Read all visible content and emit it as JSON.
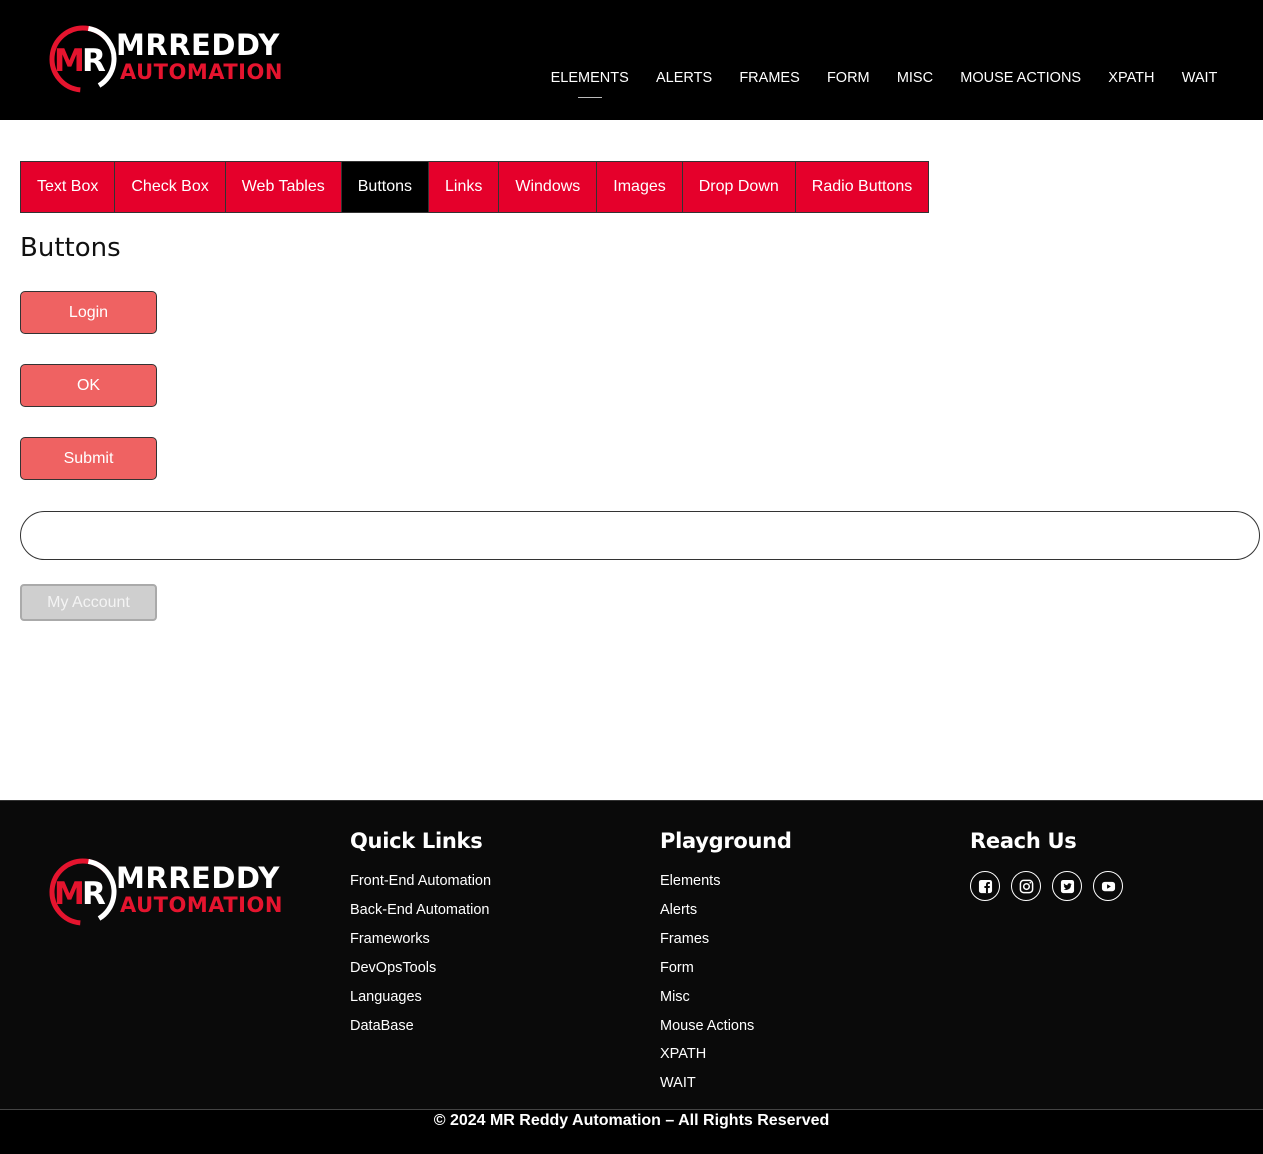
{
  "brand": {
    "line1": "MRREDDY",
    "line2": "AUTOMATION",
    "initials": "MR",
    "colors": {
      "accent": "#e5142e",
      "header_bg": "#000000"
    }
  },
  "topnav": {
    "items": [
      {
        "label": "ELEMENTS",
        "active": true
      },
      {
        "label": "ALERTS"
      },
      {
        "label": "FRAMES"
      },
      {
        "label": "FORM"
      },
      {
        "label": "MISC"
      },
      {
        "label": "MOUSE ACTIONS"
      },
      {
        "label": "XPATH"
      },
      {
        "label": "WAIT"
      }
    ]
  },
  "tabs": {
    "items": [
      {
        "label": "Text Box"
      },
      {
        "label": "Check Box"
      },
      {
        "label": "Web Tables"
      },
      {
        "label": "Buttons",
        "active": true
      },
      {
        "label": "Links"
      },
      {
        "label": "Windows"
      },
      {
        "label": "Images"
      },
      {
        "label": "Drop Down"
      },
      {
        "label": "Radio Buttons"
      }
    ],
    "colors": {
      "tab_bg": "#e5002b",
      "active_bg": "#000000"
    }
  },
  "main": {
    "title": "Buttons",
    "login_label": "Login",
    "ok_label": "OK",
    "submit_label": "Submit",
    "wide_input_value": "",
    "account_label": "My Account",
    "button_color": "#ef6262",
    "disabled_color": "#cfcfcf"
  },
  "footer": {
    "quick_links": {
      "heading": "Quick Links",
      "items": [
        "Front-End Automation",
        "Back-End Automation",
        "Frameworks",
        "DevOpsTools",
        "Languages",
        "DataBase"
      ]
    },
    "playground": {
      "heading": "Playground",
      "items": [
        "Elements",
        "Alerts",
        "Frames",
        "Form",
        "Misc",
        "Mouse Actions",
        "XPATH",
        "WAIT"
      ]
    },
    "reach_us": {
      "heading": "Reach Us",
      "icons": [
        "facebook-icon",
        "instagram-icon",
        "twitter-icon",
        "youtube-icon"
      ]
    },
    "copyright": "© 2024 MR Reddy Automation –  All Rights Reserved"
  }
}
